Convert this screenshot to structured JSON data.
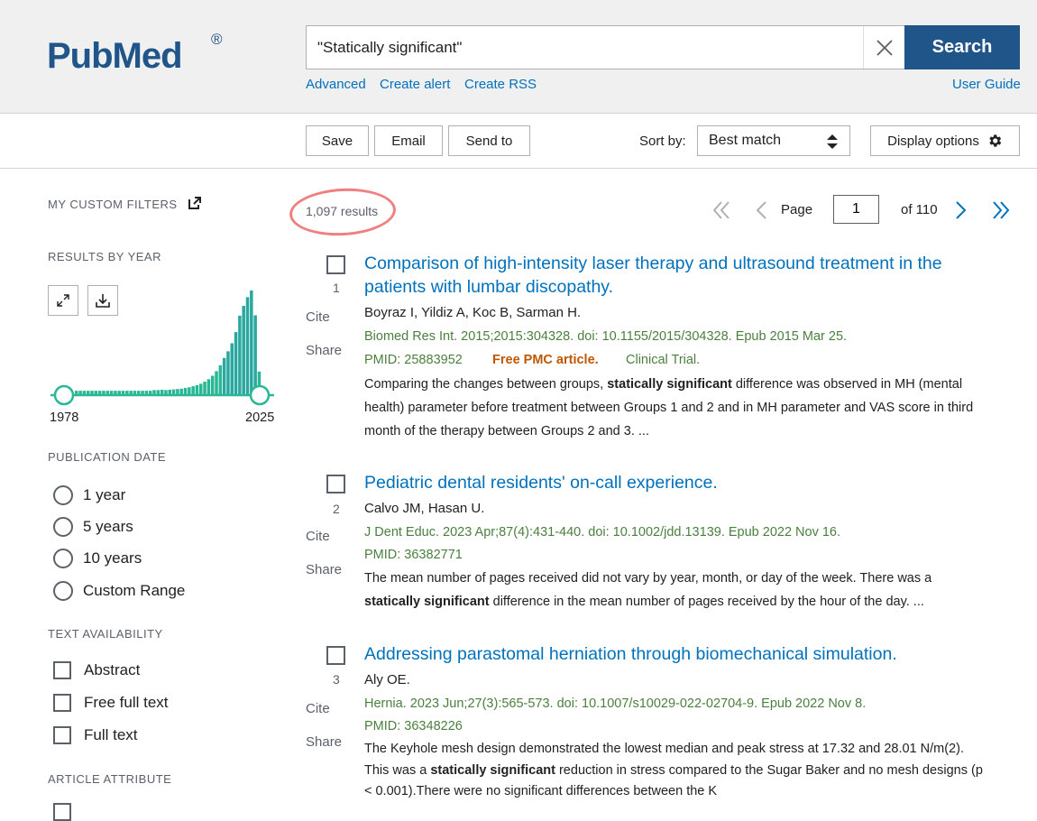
{
  "header": {
    "logo_text": "PubMed",
    "logo_reg": "®",
    "search_value": "\"Statically significant\"",
    "search_button": "Search",
    "links": {
      "advanced": "Advanced",
      "create_alert": "Create alert",
      "create_rss": "Create RSS",
      "user_guide": "User Guide"
    }
  },
  "toolbar": {
    "save": "Save",
    "email": "Email",
    "send_to": "Send to",
    "sort_label": "Sort by:",
    "sort_value": "Best match",
    "display_options": "Display options"
  },
  "sidebar": {
    "custom_filters": "MY CUSTOM FILTERS",
    "results_by_year": "RESULTS BY YEAR",
    "year_start": "1978",
    "year_end": "2025",
    "histogram": [
      1,
      1,
      1,
      1,
      1,
      1,
      1,
      1,
      1,
      1,
      1,
      1,
      1,
      1,
      1,
      1,
      1,
      1,
      1,
      1,
      1.2,
      1.2,
      1.3,
      1.2,
      1.3,
      1.4,
      1.5,
      1.6,
      1.8,
      2,
      2.3,
      2.6,
      3,
      3.6,
      4.3,
      5.3,
      6.6,
      8.3,
      10.4,
      12.3,
      14.6,
      17.8,
      22.5,
      25.3,
      27.8,
      29.7,
      22.6,
      6.5
    ],
    "publication_date": "PUBLICATION DATE",
    "date_options": [
      "1 year",
      "5 years",
      "10 years",
      "Custom Range"
    ],
    "text_availability": "TEXT AVAILABILITY",
    "text_options": [
      "Abstract",
      "Free full text",
      "Full text"
    ],
    "article_attribute": "ARTICLE ATTRIBUTE"
  },
  "results": {
    "count": "1,097 results",
    "page_label": "Page",
    "page_value": "1",
    "of_pages": "of 110",
    "cite": "Cite",
    "share": "Share",
    "items": [
      {
        "num": "1",
        "title": "Comparison of high-intensity laser therapy and ultrasound treatment in the patients with lumbar discopathy.",
        "authors": "Boyraz I, Yildiz A, Koc B, Sarman H.",
        "citation": "Biomed Res Int. 2015;2015:304328. doi: 10.1155/2015/304328. Epub 2015 Mar 25.",
        "pmid": "PMID: 25883952",
        "free": "Free PMC article.",
        "type": "Clinical Trial.",
        "snippet_pre": "Comparing the changes between groups, ",
        "snippet_bold": "statically significant",
        "snippet_post": " difference was observed in MH (mental health) parameter before treatment between Groups 1 and 2 and in MH parameter and VAS score in third month of the therapy between Groups 2 and 3. ..."
      },
      {
        "num": "2",
        "title": "Pediatric dental residents' on-call experience.",
        "authors": "Calvo JM, Hasan U.",
        "citation": "J Dent Educ. 2023 Apr;87(4):431-440. doi: 10.1002/jdd.13139. Epub 2022 Nov 16.",
        "pmid": "PMID: 36382771",
        "snippet_pre": "The mean number of pages received did not vary by year, month, or day of the week. There was a ",
        "snippet_bold": "statically significant",
        "snippet_post": " difference in the mean number of pages received by the hour of the day. ..."
      },
      {
        "num": "3",
        "title": "Addressing parastomal herniation through biomechanical simulation.",
        "authors": "Aly OE.",
        "citation": "Hernia. 2023 Jun;27(3):565-573. doi: 10.1007/s10029-022-02704-9. Epub 2022 Nov 8.",
        "pmid": "PMID: 36348226",
        "snippet_pre": "The Keyhole mesh design demonstrated the lowest median and peak stress at 17.32 and 28.01 N/m(2). This was a ",
        "snippet_bold": "statically significant",
        "snippet_post": " reduction in stress compared to the Sugar Baker and no mesh designs (p < 0.001).There were no significant differences between the K"
      }
    ]
  },
  "colors": {
    "brand": "#20558a",
    "link": "#0071bc",
    "citation": "#4b7f3e",
    "free": "#c05600",
    "annotation": "#f08080"
  }
}
